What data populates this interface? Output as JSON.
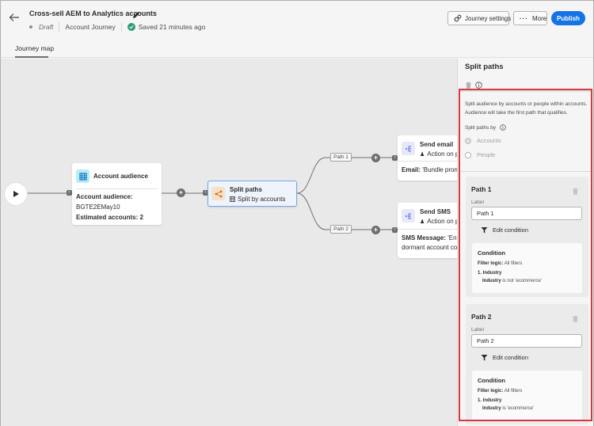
{
  "header": {
    "title": "Cross-sell AEM to Analytics accounts",
    "status": "Draft",
    "journey_type": "Account Journey",
    "saved": "Saved 21 minutes ago",
    "buttons": {
      "settings": "Journey settings",
      "more": "More",
      "publish": "Publish"
    },
    "tabs": [
      {
        "label": "Journey map",
        "active": true
      }
    ]
  },
  "canvas": {
    "audience_node": {
      "title": "Account audience",
      "audience_label": "Account audience:",
      "audience_value": "BGTE2EMay10",
      "estimated_label": "Estimated accounts:",
      "estimated_value": "2"
    },
    "split_node": {
      "title": "Split paths",
      "subtitle": "Split by accounts"
    },
    "paths": [
      {
        "label": "Path 1"
      },
      {
        "label": "Path 2"
      }
    ],
    "email_node": {
      "title": "Send email",
      "subtitle": "Action on p",
      "detail_label": "Email:",
      "detail_value": "'Bundle promo"
    },
    "sms_node": {
      "title": "Send SMS",
      "subtitle": "Action on p",
      "detail_label": "SMS Message:",
      "detail_value": "'Engag",
      "detail_line2": "dormant account con"
    }
  },
  "panel": {
    "title": "Split paths",
    "description": "Split audience by accounts or people within accounts. Audience will take the first path that qualifies.",
    "split_by_label": "Split paths by",
    "options": [
      {
        "label": "Accounts",
        "selected": true
      },
      {
        "label": "People",
        "selected": false
      }
    ],
    "path_cards": [
      {
        "title": "Path 1",
        "label_caption": "Label",
        "label_value": "Path 1",
        "edit_condition": "Edit condition",
        "condition_title": "Condition",
        "filter_logic_label": "Filter logic:",
        "filter_logic_value": "All filters",
        "item": "1. Industry",
        "rule_field": "Industry",
        "rule_text": "is not 'ecommerce'"
      },
      {
        "title": "Path 2",
        "label_caption": "Label",
        "label_value": "Path 2",
        "edit_condition": "Edit condition",
        "condition_title": "Condition",
        "filter_logic_label": "Filter logic:",
        "filter_logic_value": "All filters",
        "item": "1. Industry",
        "rule_field": "Industry",
        "rule_text": "is 'ecommerce'"
      }
    ]
  },
  "colors": {
    "accent": "#1473e6",
    "success": "#2d9d78",
    "highlight": "#d7373f",
    "split_icon": "#d0721f"
  }
}
